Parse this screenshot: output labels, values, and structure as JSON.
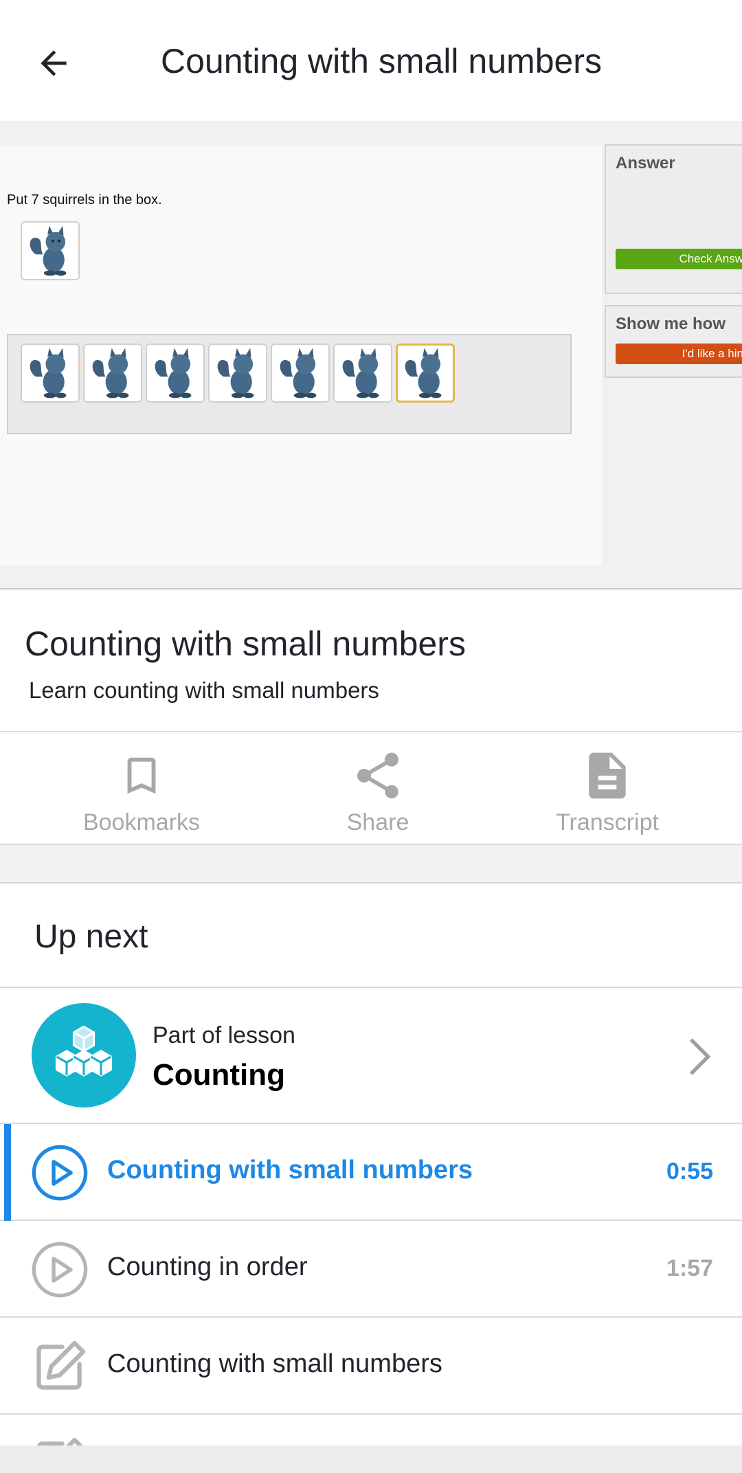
{
  "appbar": {
    "title": "Counting with small numbers",
    "back_icon": "arrow-left-icon"
  },
  "video": {
    "prompt": "Put 7 squirrels in the box.",
    "answer_header": "Answer",
    "check_button": "Check Answ",
    "show_me_header": "Show me how",
    "hint_button": "I'd like a hin",
    "squirrel_count_in_box": 7,
    "colors": {
      "check": "#5aa514",
      "hint": "#d34e13",
      "selected": "#e2b84a"
    }
  },
  "video_info": {
    "title": "Counting with small numbers",
    "subtitle": "Learn counting with small numbers"
  },
  "actions": [
    {
      "label": "Bookmarks",
      "icon": "bookmark-icon"
    },
    {
      "label": "Share",
      "icon": "share-icon"
    },
    {
      "label": "Transcript",
      "icon": "document-icon"
    }
  ],
  "up_next": {
    "title": "Up next",
    "lesson": {
      "caption": "Part of lesson",
      "name": "Counting",
      "icon": "blocks-icon"
    },
    "items": [
      {
        "title": "Counting with small numbers",
        "duration": "0:55",
        "type": "video",
        "active": true
      },
      {
        "title": "Counting in order",
        "duration": "1:57",
        "type": "video",
        "active": false
      },
      {
        "title": "Counting with small numbers",
        "duration": "",
        "type": "exercise",
        "active": false
      }
    ]
  },
  "colors": {
    "accent": "#1e88e5",
    "lesson_bg": "#14b3ce"
  }
}
